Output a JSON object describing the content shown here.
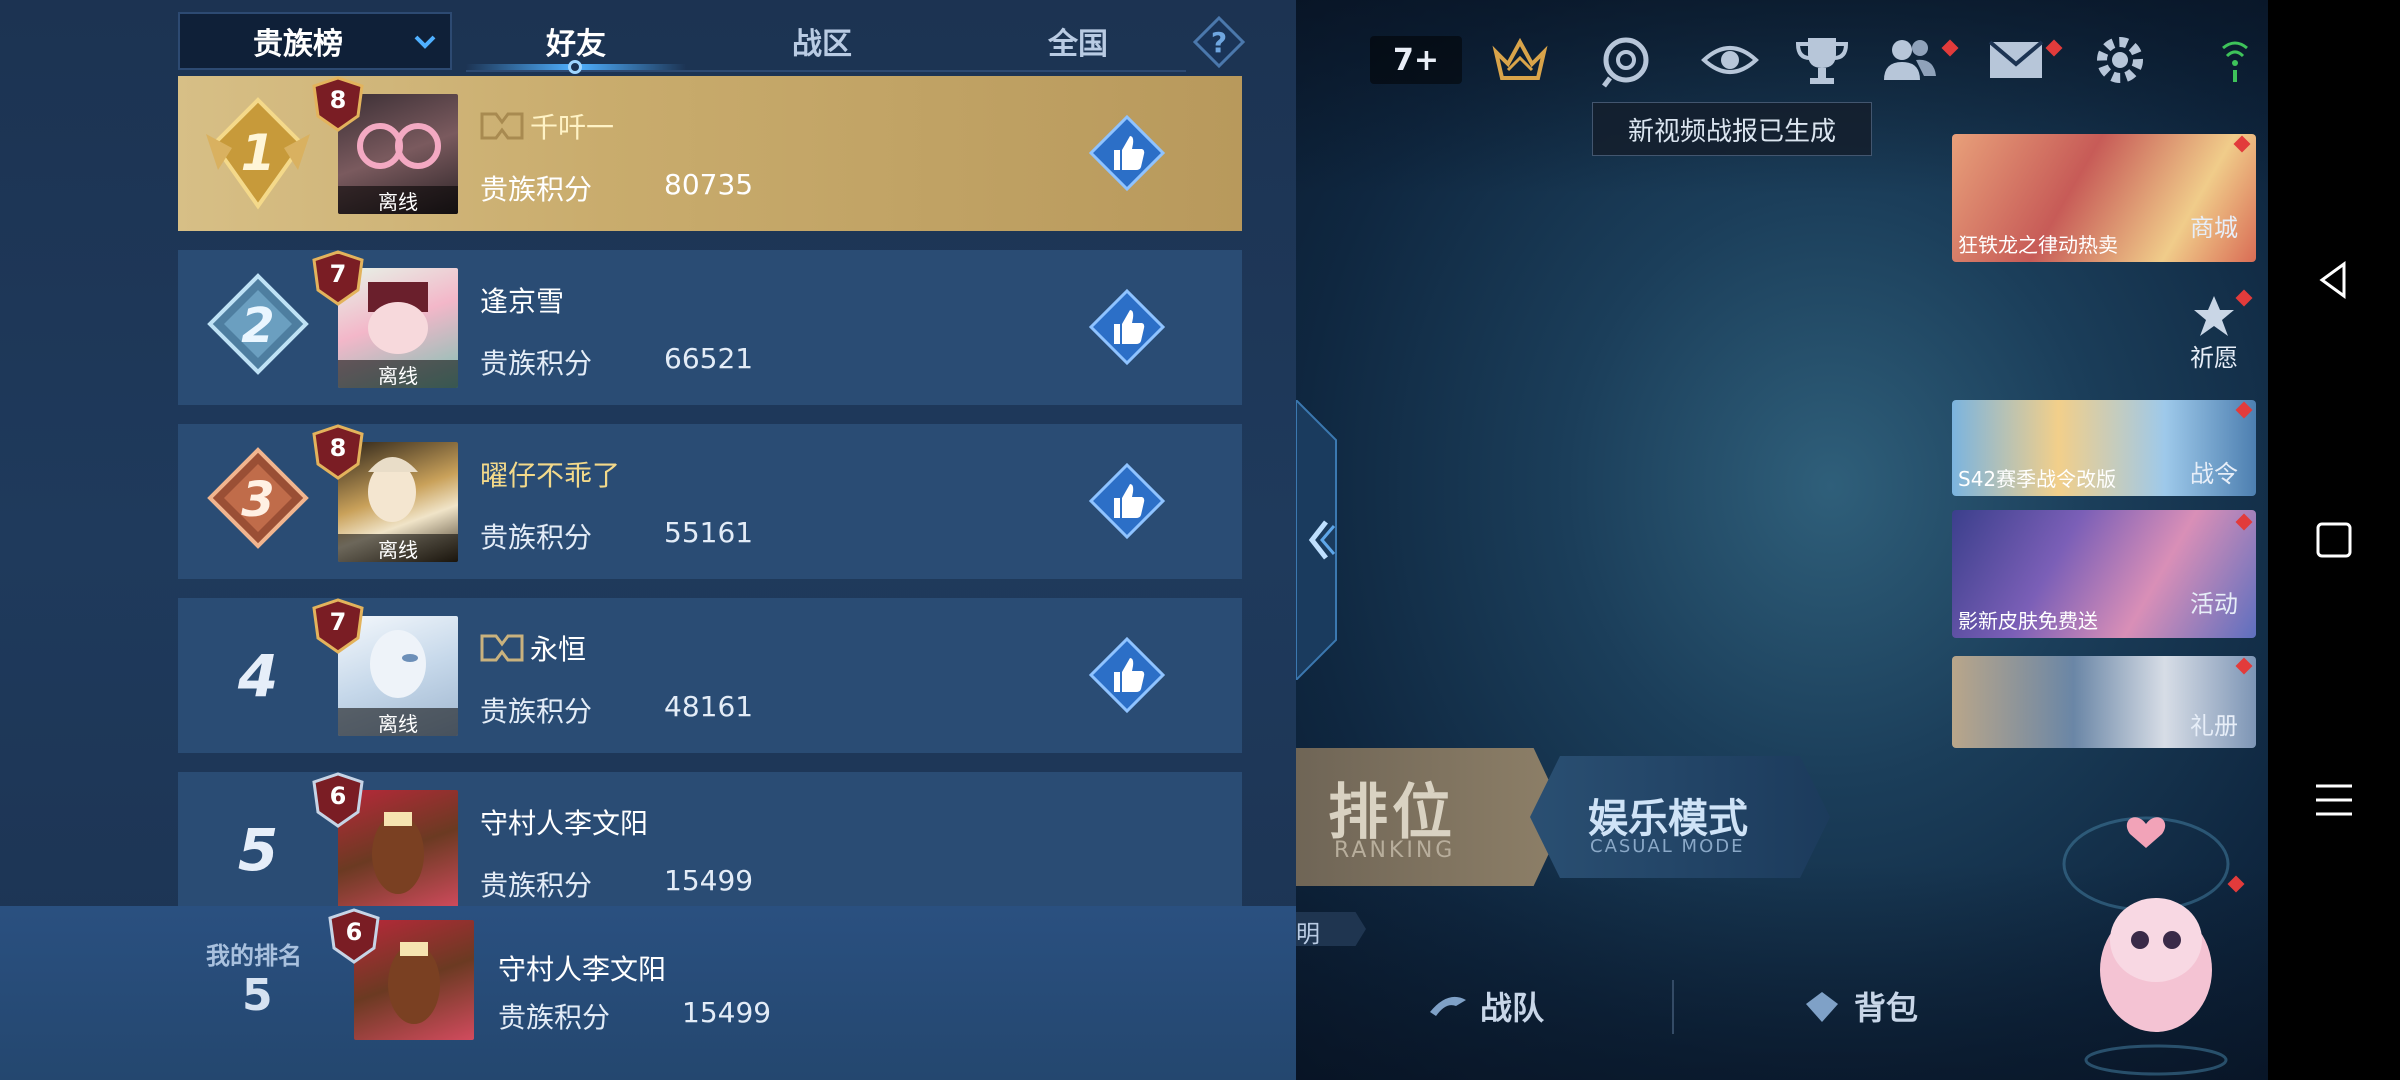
{
  "leaderboard": {
    "dropdown_label": "贵族榜",
    "tabs": [
      {
        "label": "好友",
        "active": true
      },
      {
        "label": "战区",
        "active": false
      },
      {
        "label": "全国",
        "active": false
      }
    ],
    "help_symbol": "?",
    "score_label": "贵族积分",
    "offline_label": "离线",
    "rows": [
      {
        "rank": "1",
        "level": "8",
        "name": "千吀一",
        "score": "80735",
        "has_nobility_icon": true
      },
      {
        "rank": "2",
        "level": "7",
        "name": "逢京雪",
        "score": "66521",
        "has_nobility_icon": false
      },
      {
        "rank": "3",
        "level": "8",
        "name": "曜仔不乖了",
        "score": "55161",
        "has_nobility_icon": false
      },
      {
        "rank": "4",
        "level": "7",
        "name": "永恒",
        "score": "48161",
        "has_nobility_icon": true
      },
      {
        "rank": "5",
        "level": "6",
        "name": "守村人李文阳",
        "score": "15499",
        "has_nobility_icon": false
      }
    ],
    "my_rank": {
      "label": "我的排名",
      "rank": "5",
      "level": "6",
      "name": "守村人李文阳",
      "score": "15499"
    }
  },
  "lobby": {
    "plus_counter": "7+",
    "tooltip": "新视频战报已生成",
    "promos": [
      {
        "caption": "狂铁龙之律动热卖",
        "side_label": "商城"
      },
      {
        "caption": "",
        "side_label": "祈愿"
      },
      {
        "caption": "S42赛季战令改版",
        "side_label": "战令"
      },
      {
        "caption": "影新皮肤免费送",
        "side_label": "活动"
      },
      {
        "caption": "",
        "side_label": "礼册"
      }
    ],
    "mode_rank_title": "排位",
    "mode_rank_sub": "RANKING",
    "mode_casual_title": "娱乐模式",
    "mode_casual_sub": "CASUAL MODE",
    "partial_text": "明",
    "bottom_team": "战队",
    "bottom_bag": "背包"
  },
  "icons": [
    "chevron-down-icon",
    "help-icon",
    "like-icon",
    "nobility-icon",
    "rank-1-badge",
    "rank-2-badge",
    "rank-3-badge",
    "level-badge",
    "collapse-arrow-icon",
    "crown-icon",
    "camera-icon",
    "eye-icon",
    "trophy-icon",
    "friends-icon",
    "mail-icon",
    "gear-icon",
    "wifi-icon",
    "back-icon",
    "home-icon",
    "menu-icon"
  ],
  "colors": {
    "panel_bg": "#1f3a5c",
    "row_bg": "#2a4c74",
    "first_row_gold": "#c9ac6d",
    "like_blue": "#2f7ad8",
    "active_tab_underline": "#4fb0ff"
  }
}
